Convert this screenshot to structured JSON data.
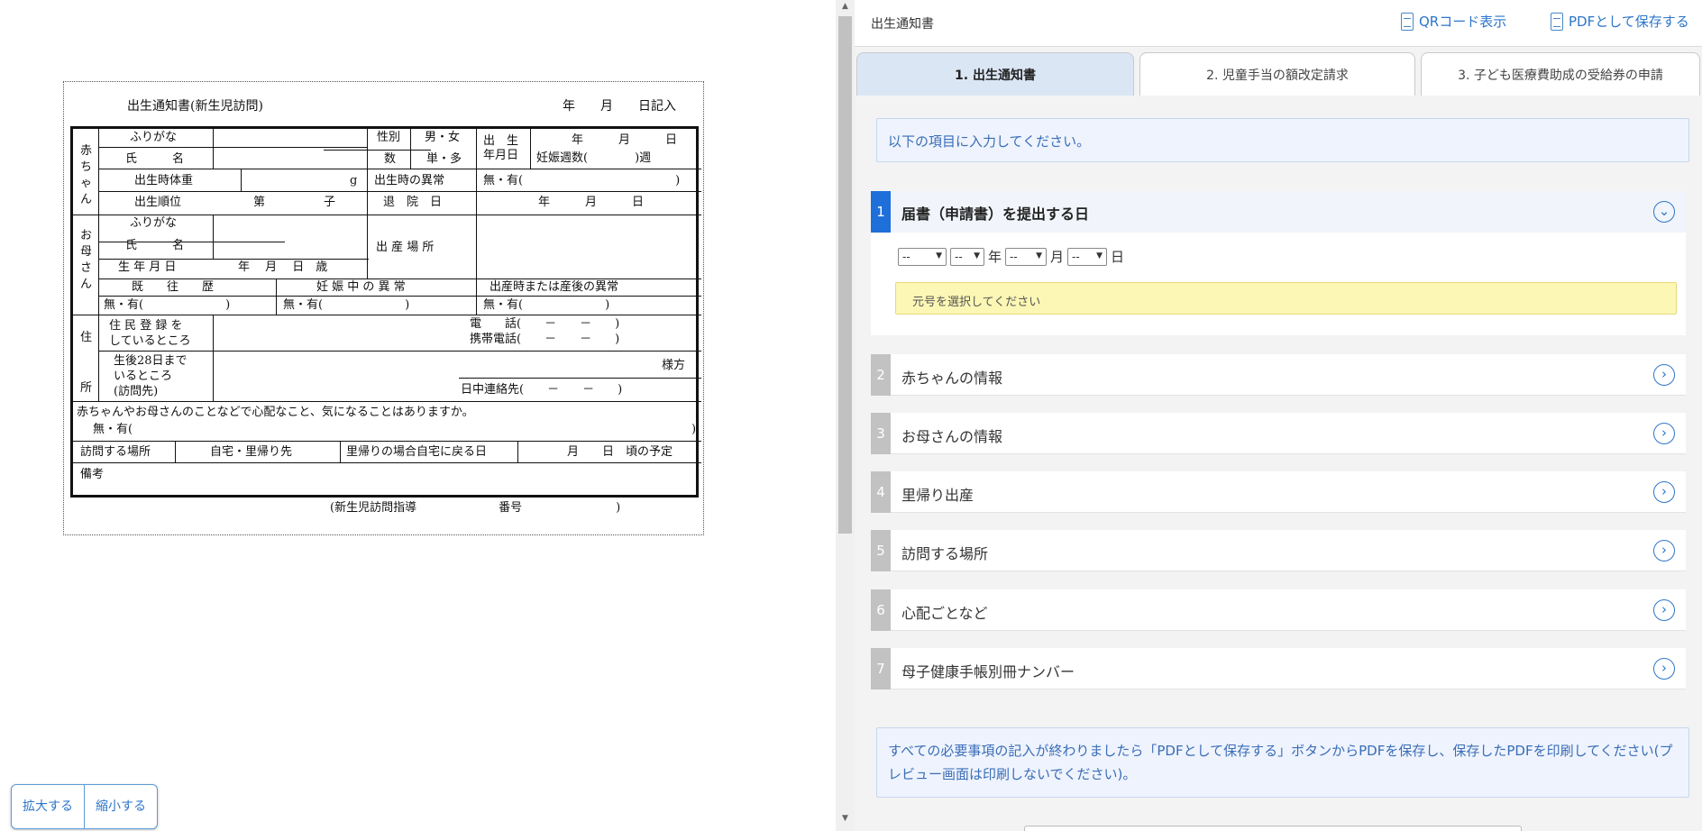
{
  "preview": {
    "doc": {
      "title": "出生通知書(新生児訪問)",
      "date_label": "年　　月　　日記入",
      "baby_group": "赤\nち\nゃ\nん",
      "mother_group": "お\n母\nさ\nん",
      "address_group": "住\n\n所",
      "furigana": "ふりがな",
      "name": "氏　　　名",
      "sex": "性別",
      "male_female": "男・女",
      "birth_count": "数",
      "single_multi": "単・多",
      "birth_date": "出　生\n年月日",
      "ymd": "年　　　月　　　日",
      "gestation": "妊娠週数(　　　　)週",
      "birth_weight": "出生時体重",
      "g": "g",
      "birth_abnormal": "出生時の異常",
      "none_yes_paren": "無・有(　　　　　　　　　　　　　)",
      "birth_order": "出生順位",
      "dai_ko": "第　　　　　子",
      "discharge": "退　院　日",
      "discharge_ymd": "年　　　月　　　日",
      "mother_birth": "生 年 月 日",
      "mother_age": "年　 月　 日　歳",
      "birth_place": "出 産 場 所",
      "history": "既　　往　　歴",
      "pregnancy_abnormal": "妊 娠 中 の 異 常",
      "postpartum_abnormal": "出産時または産後の異常",
      "history_val": "無・有(　　　　　　　)",
      "pregnancy_val": "無・有(　　　　　　　)",
      "postpartum_val": "無・有(　　　　　　　)",
      "registered_address": "住 民 登 録 を\nしているところ",
      "phone": "電　　話(　　－　　－　　)",
      "mobile": "携帯電話(　　－　　－　　)",
      "stay_address": "生後28日まで\nいるところ\n(訪問先)",
      "sama": "様方",
      "day_contact": "日中連絡先(　　－　　－　　)",
      "worry_q": "赤ちゃんやお母さんのことなどで心配なこと、気になることはありますか。",
      "worry_val": "無・有(",
      "worry_close": ")",
      "visit_place": "訪問する場所",
      "home_return": "自宅・里帰り先",
      "return_date": "里帰りの場合自宅に戻る日",
      "planned": "月　　日　頃の予定",
      "notes": "備考",
      "footer": "(新生児訪問指導　　　　　　　番号　　　　　　　　)"
    },
    "zoom_in": "拡大する",
    "zoom_out": "縮小する"
  },
  "header": {
    "title": "出生通知書",
    "qr_button": "QRコード表示",
    "pdf_button": "PDFとして保存する"
  },
  "tabs": [
    {
      "label": "1. 出生通知書",
      "active": true
    },
    {
      "label": "2. 児童手当の額改定請求",
      "active": false
    },
    {
      "label": "3. 子ども医療費助成の受給券の申請",
      "active": false
    }
  ],
  "info_message": "以下の項目に入力してください。",
  "sections": [
    {
      "num": "1",
      "label": "届書（申請書）を提出する日",
      "expanded": true
    },
    {
      "num": "2",
      "label": "赤ちゃんの情報"
    },
    {
      "num": "3",
      "label": "お母さんの情報"
    },
    {
      "num": "4",
      "label": "里帰り出産"
    },
    {
      "num": "5",
      "label": "訪問する場所"
    },
    {
      "num": "6",
      "label": "心配ごとなど"
    },
    {
      "num": "7",
      "label": "母子健康手帳別冊ナンバー"
    }
  ],
  "date_select": {
    "era": "--",
    "year": "--",
    "year_unit": "年",
    "month": "--",
    "month_unit": "月",
    "day": "--",
    "day_unit": "日"
  },
  "warning": "元号を選択してください",
  "footer_note": "すべての必要事項の記入が終わりましたら「PDFとして保存する」ボタンからPDFを保存し、保存したPDFを印刷してください(プレビュー画面は印刷しないでください)。",
  "colors": {
    "accent": "#2e75c9",
    "active_num": "#1e6fd9",
    "warning_bg": "#fdf7b5",
    "info_bg": "#eef3fd"
  }
}
